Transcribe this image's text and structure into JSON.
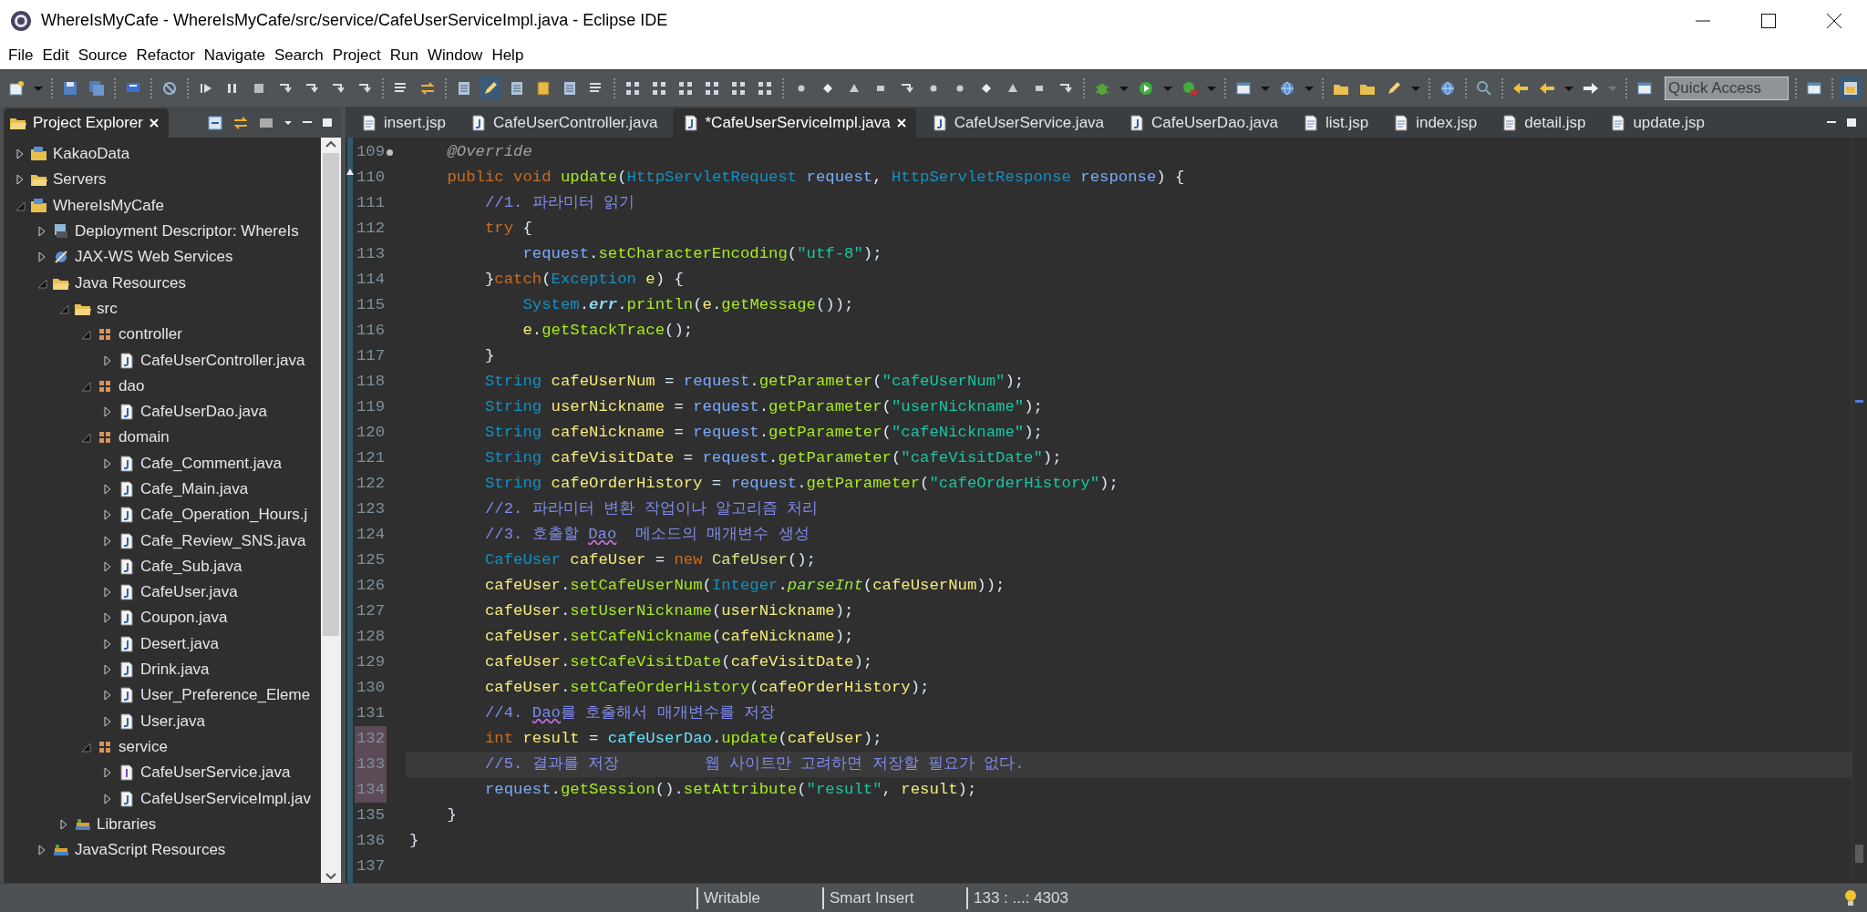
{
  "window": {
    "title": "WhereIsMyCafe - WhereIsMyCafe/src/service/CafeUserServiceImpl.java - Eclipse IDE"
  },
  "menu": [
    "File",
    "Edit",
    "Source",
    "Refactor",
    "Navigate",
    "Search",
    "Project",
    "Run",
    "Window",
    "Help"
  ],
  "quick_access": {
    "placeholder": "Quick Access"
  },
  "sidebar": {
    "tab": {
      "label": "Project Explorer",
      "selected": true
    },
    "tree": [
      {
        "label": "KakaoData",
        "kind": "project",
        "expanded": false
      },
      {
        "label": "Servers",
        "kind": "folder",
        "expanded": false
      },
      {
        "label": "WhereIsMyCafe",
        "kind": "project",
        "expanded": true,
        "children": [
          {
            "label": "Deployment Descriptor: WhereIs",
            "kind": "descriptor",
            "expanded": false
          },
          {
            "label": "JAX-WS Web Services",
            "kind": "webservice",
            "expanded": false
          },
          {
            "label": "Java Resources",
            "kind": "folder",
            "expanded": true,
            "children": [
              {
                "label": "src",
                "kind": "folder",
                "expanded": true,
                "children": [
                  {
                    "label": "controller",
                    "kind": "package",
                    "expanded": true,
                    "children": [
                      {
                        "label": "CafeUserController.java",
                        "kind": "java",
                        "expanded": false
                      }
                    ]
                  },
                  {
                    "label": "dao",
                    "kind": "package",
                    "expanded": true,
                    "children": [
                      {
                        "label": "CafeUserDao.java",
                        "kind": "java",
                        "expanded": false
                      }
                    ]
                  },
                  {
                    "label": "domain",
                    "kind": "package",
                    "expanded": true,
                    "children": [
                      {
                        "label": "Cafe_Comment.java",
                        "kind": "java",
                        "expanded": false
                      },
                      {
                        "label": "Cafe_Main.java",
                        "kind": "java",
                        "expanded": false
                      },
                      {
                        "label": "Cafe_Operation_Hours.j",
                        "kind": "java",
                        "expanded": false
                      },
                      {
                        "label": "Cafe_Review_SNS.java",
                        "kind": "java",
                        "expanded": false
                      },
                      {
                        "label": "Cafe_Sub.java",
                        "kind": "java",
                        "expanded": false
                      },
                      {
                        "label": "CafeUser.java",
                        "kind": "java",
                        "expanded": false
                      },
                      {
                        "label": "Coupon.java",
                        "kind": "java",
                        "expanded": false
                      },
                      {
                        "label": "Desert.java",
                        "kind": "java",
                        "expanded": false
                      },
                      {
                        "label": "Drink.java",
                        "kind": "java",
                        "expanded": false
                      },
                      {
                        "label": "User_Preference_Eleme",
                        "kind": "java",
                        "expanded": false
                      },
                      {
                        "label": "User.java",
                        "kind": "java",
                        "expanded": false
                      }
                    ]
                  },
                  {
                    "label": "service",
                    "kind": "package",
                    "expanded": true,
                    "children": [
                      {
                        "label": "CafeUserService.java",
                        "kind": "interface",
                        "expanded": false
                      },
                      {
                        "label": "CafeUserServiceImpl.jav",
                        "kind": "java",
                        "expanded": false
                      }
                    ]
                  }
                ]
              },
              {
                "label": "Libraries",
                "kind": "library",
                "expanded": false
              }
            ]
          },
          {
            "label": "JavaScript Resources",
            "kind": "library",
            "expanded": false
          }
        ]
      }
    ]
  },
  "editor": {
    "tabs": [
      {
        "label": "insert.jsp",
        "kind": "jsp",
        "selected": false
      },
      {
        "label": "CafeUserController.java",
        "kind": "java",
        "selected": false
      },
      {
        "label": "*CafeUserServiceImpl.java",
        "kind": "java",
        "selected": true
      },
      {
        "label": "CafeUserService.java",
        "kind": "java",
        "selected": false
      },
      {
        "label": "CafeUserDao.java",
        "kind": "java",
        "selected": false
      },
      {
        "label": "list.jsp",
        "kind": "jsp",
        "selected": false
      },
      {
        "label": "index.jsp",
        "kind": "jsp",
        "selected": false
      },
      {
        "label": "detail.jsp",
        "kind": "jsp",
        "selected": false
      },
      {
        "label": "update.jsp",
        "kind": "jsp",
        "selected": false
      }
    ],
    "lines": [
      {
        "number": "109",
        "kind": "fold",
        "changed": false,
        "current": false,
        "tokens": [
          {
            "text": "    @Override",
            "kind": "anno"
          }
        ]
      },
      {
        "number": "110",
        "kind": "override",
        "changed": false,
        "current": false,
        "tokens": [
          {
            "text": "    public",
            "kind": "kw"
          },
          {
            "text": " void",
            "kind": "kw"
          },
          {
            "text": " update",
            "kind": "method"
          },
          {
            "text": "(",
            "kind": "plain"
          },
          {
            "text": "HttpServletRequest",
            "kind": "type"
          },
          {
            "text": " request",
            "kind": "param"
          },
          {
            "text": ", ",
            "kind": "plain"
          },
          {
            "text": "HttpServletResponse",
            "kind": "type"
          },
          {
            "text": " response",
            "kind": "param"
          },
          {
            "text": ") {",
            "kind": "plain"
          }
        ]
      },
      {
        "number": "111",
        "kind": "code",
        "changed": false,
        "current": false,
        "tokens": [
          {
            "text": "        //1. 파라미터 읽기",
            "kind": "comment"
          }
        ]
      },
      {
        "number": "112",
        "kind": "code",
        "changed": false,
        "current": false,
        "tokens": [
          {
            "text": "        try",
            "kind": "kw"
          },
          {
            "text": " {",
            "kind": "plain"
          }
        ]
      },
      {
        "number": "113",
        "kind": "code",
        "changed": false,
        "current": false,
        "tokens": [
          {
            "text": "            request",
            "kind": "param"
          },
          {
            "text": ".",
            "kind": "plain"
          },
          {
            "text": "setCharacterEncoding",
            "kind": "method"
          },
          {
            "text": "(",
            "kind": "plain"
          },
          {
            "text": "\"utf-8\"",
            "kind": "string"
          },
          {
            "text": ");",
            "kind": "plain"
          }
        ]
      },
      {
        "number": "114",
        "kind": "code",
        "changed": false,
        "current": false,
        "tokens": [
          {
            "text": "        }",
            "kind": "plain"
          },
          {
            "text": "catch",
            "kind": "kw"
          },
          {
            "text": "(",
            "kind": "plain"
          },
          {
            "text": "Exception",
            "kind": "type"
          },
          {
            "text": " e",
            "kind": "local"
          },
          {
            "text": ") {",
            "kind": "plain"
          }
        ]
      },
      {
        "number": "115",
        "kind": "code",
        "changed": false,
        "current": false,
        "tokens": [
          {
            "text": "            System",
            "kind": "type"
          },
          {
            "text": ".",
            "kind": "plain"
          },
          {
            "text": "err",
            "kind": "static_field"
          },
          {
            "text": ".",
            "kind": "plain"
          },
          {
            "text": "println",
            "kind": "method"
          },
          {
            "text": "(",
            "kind": "plain"
          },
          {
            "text": "e",
            "kind": "local"
          },
          {
            "text": ".",
            "kind": "plain"
          },
          {
            "text": "getMessage",
            "kind": "method"
          },
          {
            "text": "());",
            "kind": "plain"
          }
        ]
      },
      {
        "number": "116",
        "kind": "code",
        "changed": false,
        "current": false,
        "tokens": [
          {
            "text": "            e",
            "kind": "local"
          },
          {
            "text": ".",
            "kind": "plain"
          },
          {
            "text": "getStackTrace",
            "kind": "method"
          },
          {
            "text": "();",
            "kind": "plain"
          }
        ]
      },
      {
        "number": "117",
        "kind": "code",
        "changed": false,
        "current": false,
        "tokens": [
          {
            "text": "        }",
            "kind": "plain"
          }
        ]
      },
      {
        "number": "118",
        "kind": "code",
        "changed": false,
        "current": false,
        "tokens": [
          {
            "text": "        String",
            "kind": "type"
          },
          {
            "text": " cafeUserNum",
            "kind": "local"
          },
          {
            "text": " = ",
            "kind": "plain"
          },
          {
            "text": "request",
            "kind": "param"
          },
          {
            "text": ".",
            "kind": "plain"
          },
          {
            "text": "getParameter",
            "kind": "method"
          },
          {
            "text": "(",
            "kind": "plain"
          },
          {
            "text": "\"cafeUserNum\"",
            "kind": "string"
          },
          {
            "text": ");",
            "kind": "plain"
          }
        ]
      },
      {
        "number": "119",
        "kind": "code",
        "changed": false,
        "current": false,
        "tokens": [
          {
            "text": "        String",
            "kind": "type"
          },
          {
            "text": " userNickname",
            "kind": "local"
          },
          {
            "text": " = ",
            "kind": "plain"
          },
          {
            "text": "request",
            "kind": "param"
          },
          {
            "text": ".",
            "kind": "plain"
          },
          {
            "text": "getParameter",
            "kind": "method"
          },
          {
            "text": "(",
            "kind": "plain"
          },
          {
            "text": "\"userNickname\"",
            "kind": "string"
          },
          {
            "text": ");",
            "kind": "plain"
          }
        ]
      },
      {
        "number": "120",
        "kind": "code",
        "changed": false,
        "current": false,
        "tokens": [
          {
            "text": "        String",
            "kind": "type"
          },
          {
            "text": " cafeNickname",
            "kind": "local"
          },
          {
            "text": " = ",
            "kind": "plain"
          },
          {
            "text": "request",
            "kind": "param"
          },
          {
            "text": ".",
            "kind": "plain"
          },
          {
            "text": "getParameter",
            "kind": "method"
          },
          {
            "text": "(",
            "kind": "plain"
          },
          {
            "text": "\"cafeNickname\"",
            "kind": "string"
          },
          {
            "text": ");",
            "kind": "plain"
          }
        ]
      },
      {
        "number": "121",
        "kind": "code",
        "changed": false,
        "current": false,
        "tokens": [
          {
            "text": "        String",
            "kind": "type"
          },
          {
            "text": " cafeVisitDate",
            "kind": "local"
          },
          {
            "text": " = ",
            "kind": "plain"
          },
          {
            "text": "request",
            "kind": "param"
          },
          {
            "text": ".",
            "kind": "plain"
          },
          {
            "text": "getParameter",
            "kind": "method"
          },
          {
            "text": "(",
            "kind": "plain"
          },
          {
            "text": "\"cafeVisitDate\"",
            "kind": "string"
          },
          {
            "text": ");",
            "kind": "plain"
          }
        ]
      },
      {
        "number": "122",
        "kind": "code",
        "changed": false,
        "current": false,
        "tokens": [
          {
            "text": "        String",
            "kind": "type"
          },
          {
            "text": " cafeOrderHistory",
            "kind": "local"
          },
          {
            "text": " = ",
            "kind": "plain"
          },
          {
            "text": "request",
            "kind": "param"
          },
          {
            "text": ".",
            "kind": "plain"
          },
          {
            "text": "getParameter",
            "kind": "method"
          },
          {
            "text": "(",
            "kind": "plain"
          },
          {
            "text": "\"cafeOrderHistory\"",
            "kind": "string"
          },
          {
            "text": ");",
            "kind": "plain"
          }
        ]
      },
      {
        "number": "123",
        "kind": "code",
        "changed": false,
        "current": false,
        "tokens": [
          {
            "text": "        //2. 파라미터 변환 작업이나 알고리즘 처리",
            "kind": "comment"
          }
        ]
      },
      {
        "number": "124",
        "kind": "code",
        "changed": false,
        "current": false,
        "tokens": [
          {
            "text": "        //3. 호출할 ",
            "kind": "comment"
          },
          {
            "text": "Dao",
            "kind": "comment_warn"
          },
          {
            "text": "  메소드의 매개변수 생성",
            "kind": "comment"
          }
        ]
      },
      {
        "number": "125",
        "kind": "code",
        "changed": false,
        "current": false,
        "tokens": [
          {
            "text": "        CafeUser",
            "kind": "type"
          },
          {
            "text": " cafeUser",
            "kind": "local"
          },
          {
            "text": " = ",
            "kind": "plain"
          },
          {
            "text": "new",
            "kind": "kw"
          },
          {
            "text": " CafeUser",
            "kind": "ctor"
          },
          {
            "text": "();",
            "kind": "plain"
          }
        ]
      },
      {
        "number": "126",
        "kind": "code",
        "changed": false,
        "current": false,
        "tokens": [
          {
            "text": "        cafeUser",
            "kind": "local"
          },
          {
            "text": ".",
            "kind": "plain"
          },
          {
            "text": "setCafeUserNum",
            "kind": "method"
          },
          {
            "text": "(",
            "kind": "plain"
          },
          {
            "text": "Integer",
            "kind": "type"
          },
          {
            "text": ".",
            "kind": "plain"
          },
          {
            "text": "parseInt",
            "kind": "static_method"
          },
          {
            "text": "(",
            "kind": "plain"
          },
          {
            "text": "cafeUserNum",
            "kind": "local"
          },
          {
            "text": "));",
            "kind": "plain"
          }
        ]
      },
      {
        "number": "127",
        "kind": "code",
        "changed": false,
        "current": false,
        "tokens": [
          {
            "text": "        cafeUser",
            "kind": "local"
          },
          {
            "text": ".",
            "kind": "plain"
          },
          {
            "text": "setUserNickname",
            "kind": "method"
          },
          {
            "text": "(",
            "kind": "plain"
          },
          {
            "text": "userNickname",
            "kind": "local"
          },
          {
            "text": ");",
            "kind": "plain"
          }
        ]
      },
      {
        "number": "128",
        "kind": "code",
        "changed": false,
        "current": false,
        "tokens": [
          {
            "text": "        cafeUser",
            "kind": "local"
          },
          {
            "text": ".",
            "kind": "plain"
          },
          {
            "text": "setCafeNickname",
            "kind": "method"
          },
          {
            "text": "(",
            "kind": "plain"
          },
          {
            "text": "cafeNickname",
            "kind": "local"
          },
          {
            "text": ");",
            "kind": "plain"
          }
        ]
      },
      {
        "number": "129",
        "kind": "code",
        "changed": false,
        "current": false,
        "tokens": [
          {
            "text": "        cafeUser",
            "kind": "local"
          },
          {
            "text": ".",
            "kind": "plain"
          },
          {
            "text": "setCafeVisitDate",
            "kind": "method"
          },
          {
            "text": "(",
            "kind": "plain"
          },
          {
            "text": "cafeVisitDate",
            "kind": "local"
          },
          {
            "text": ");",
            "kind": "plain"
          }
        ]
      },
      {
        "number": "130",
        "kind": "code",
        "changed": false,
        "current": false,
        "tokens": [
          {
            "text": "        cafeUser",
            "kind": "local"
          },
          {
            "text": ".",
            "kind": "plain"
          },
          {
            "text": "setCafeOrderHistory",
            "kind": "method"
          },
          {
            "text": "(",
            "kind": "plain"
          },
          {
            "text": "cafeOrderHistory",
            "kind": "local"
          },
          {
            "text": ");",
            "kind": "plain"
          }
        ]
      },
      {
        "number": "131",
        "kind": "code",
        "changed": false,
        "current": false,
        "tokens": [
          {
            "text": "        //4. ",
            "kind": "comment"
          },
          {
            "text": "Dao",
            "kind": "comment_warn"
          },
          {
            "text": "를 호출해서 매개변수를 저장",
            "kind": "comment"
          }
        ]
      },
      {
        "number": "132",
        "kind": "code",
        "changed": true,
        "current": false,
        "tokens": [
          {
            "text": "        int",
            "kind": "kw"
          },
          {
            "text": " result",
            "kind": "local"
          },
          {
            "text": " = ",
            "kind": "plain"
          },
          {
            "text": "cafeUserDao",
            "kind": "field"
          },
          {
            "text": ".",
            "kind": "plain"
          },
          {
            "text": "update",
            "kind": "method"
          },
          {
            "text": "(",
            "kind": "plain"
          },
          {
            "text": "cafeUser",
            "kind": "local"
          },
          {
            "text": ");",
            "kind": "plain"
          }
        ]
      },
      {
        "number": "133",
        "kind": "code",
        "changed": true,
        "current": true,
        "tokens": [
          {
            "text": "        //5. 결과를 저장         웹 사이트만 고려하면 저장할 필요가 없다.",
            "kind": "comment"
          }
        ]
      },
      {
        "number": "134",
        "kind": "code",
        "changed": true,
        "current": false,
        "tokens": [
          {
            "text": "        request",
            "kind": "param"
          },
          {
            "text": ".",
            "kind": "plain"
          },
          {
            "text": "getSession",
            "kind": "method"
          },
          {
            "text": "().",
            "kind": "plain"
          },
          {
            "text": "setAttribute",
            "kind": "method"
          },
          {
            "text": "(",
            "kind": "plain"
          },
          {
            "text": "\"result\"",
            "kind": "string"
          },
          {
            "text": ", ",
            "kind": "plain"
          },
          {
            "text": "result",
            "kind": "local"
          },
          {
            "text": ");",
            "kind": "plain"
          }
        ]
      },
      {
        "number": "135",
        "kind": "code",
        "changed": false,
        "current": false,
        "tokens": [
          {
            "text": "    }",
            "kind": "plain"
          }
        ]
      },
      {
        "number": "136",
        "kind": "code",
        "changed": false,
        "current": false,
        "tokens": [
          {
            "text": "}",
            "kind": "plain"
          }
        ]
      },
      {
        "number": "137",
        "kind": "code",
        "changed": false,
        "current": false
      }
    ]
  },
  "status_bar": [
    "Writable",
    "Smart Insert",
    "133 : ...: 4303"
  ]
}
